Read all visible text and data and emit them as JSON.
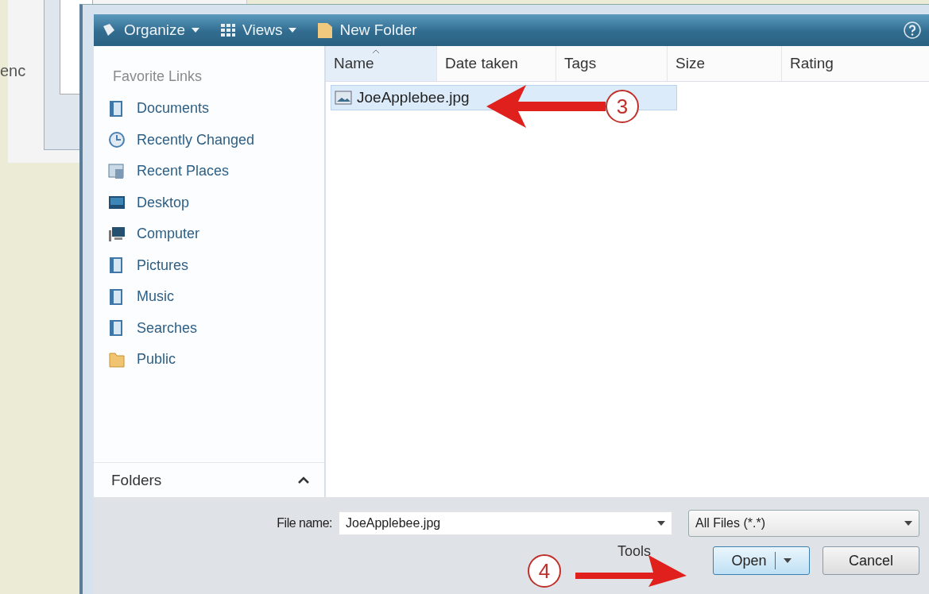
{
  "background_window": {
    "text": "enc"
  },
  "toolbar": {
    "buttons": [
      {
        "label": "Organize",
        "kind": "organize"
      },
      {
        "label": "Views",
        "kind": "views"
      },
      {
        "label": "New Folder",
        "kind": "folder"
      }
    ]
  },
  "sidebar": {
    "heading": "Favorite Links",
    "items": [
      {
        "label": "Documents",
        "kind": "library"
      },
      {
        "label": "Recently Changed",
        "kind": "recent"
      },
      {
        "label": "Recent Places",
        "kind": "places"
      },
      {
        "label": "Desktop",
        "kind": "desktop"
      },
      {
        "label": "Computer",
        "kind": "computer"
      },
      {
        "label": "Pictures",
        "kind": "library"
      },
      {
        "label": "Music",
        "kind": "library"
      },
      {
        "label": "Searches",
        "kind": "library"
      },
      {
        "label": "Public",
        "kind": "folder"
      }
    ],
    "folders_label": "Folders",
    "folders_expanded": false
  },
  "table": {
    "columns": [
      {
        "label": "Name",
        "sorted": true
      },
      {
        "label": "Date taken",
        "sorted": false
      },
      {
        "label": "Tags",
        "sorted": false
      },
      {
        "label": "Size",
        "sorted": false
      },
      {
        "label": "Rating",
        "sorted": false
      }
    ],
    "rows": [
      {
        "name": "JoeApplebee.jpg",
        "selected": true
      }
    ]
  },
  "file_name": {
    "label": "File name:",
    "value": "JoeApplebee.jpg"
  },
  "file_type": {
    "value": "All Files (*.*)"
  },
  "tools_label": "Tools",
  "buttons": [
    {
      "label": "Open",
      "kind": "split"
    },
    {
      "label": "Cancel",
      "kind": "plain"
    }
  ],
  "annotations": [
    {
      "label": "3"
    },
    {
      "label": "4"
    }
  ]
}
